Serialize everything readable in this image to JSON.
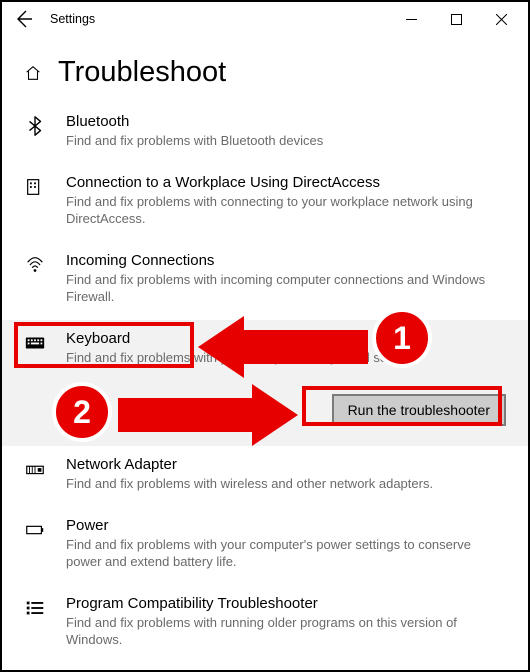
{
  "window": {
    "app_title": "Settings",
    "minimize": "—",
    "maximize": "□",
    "close": "×"
  },
  "header": {
    "title": "Troubleshoot"
  },
  "items": [
    {
      "title": "Bluetooth",
      "desc": "Find and fix problems with Bluetooth devices"
    },
    {
      "title": "Connection to a Workplace Using DirectAccess",
      "desc": "Find and fix problems with connecting to your workplace network using DirectAccess."
    },
    {
      "title": "Incoming Connections",
      "desc": "Find and fix problems with incoming computer connections and Windows Firewall."
    },
    {
      "title": "Keyboard",
      "desc": "Find and fix problems with your computer's keyboard settings."
    },
    {
      "title": "Network Adapter",
      "desc": "Find and fix problems with wireless and other network adapters."
    },
    {
      "title": "Power",
      "desc": "Find and fix problems with your computer's power settings to conserve power and extend battery life."
    },
    {
      "title": "Program Compatibility Troubleshooter",
      "desc": "Find and fix problems with running older programs on this version of Windows."
    }
  ],
  "run_button": "Run the troubleshooter",
  "annotations": {
    "step1": "1",
    "step2": "2"
  }
}
